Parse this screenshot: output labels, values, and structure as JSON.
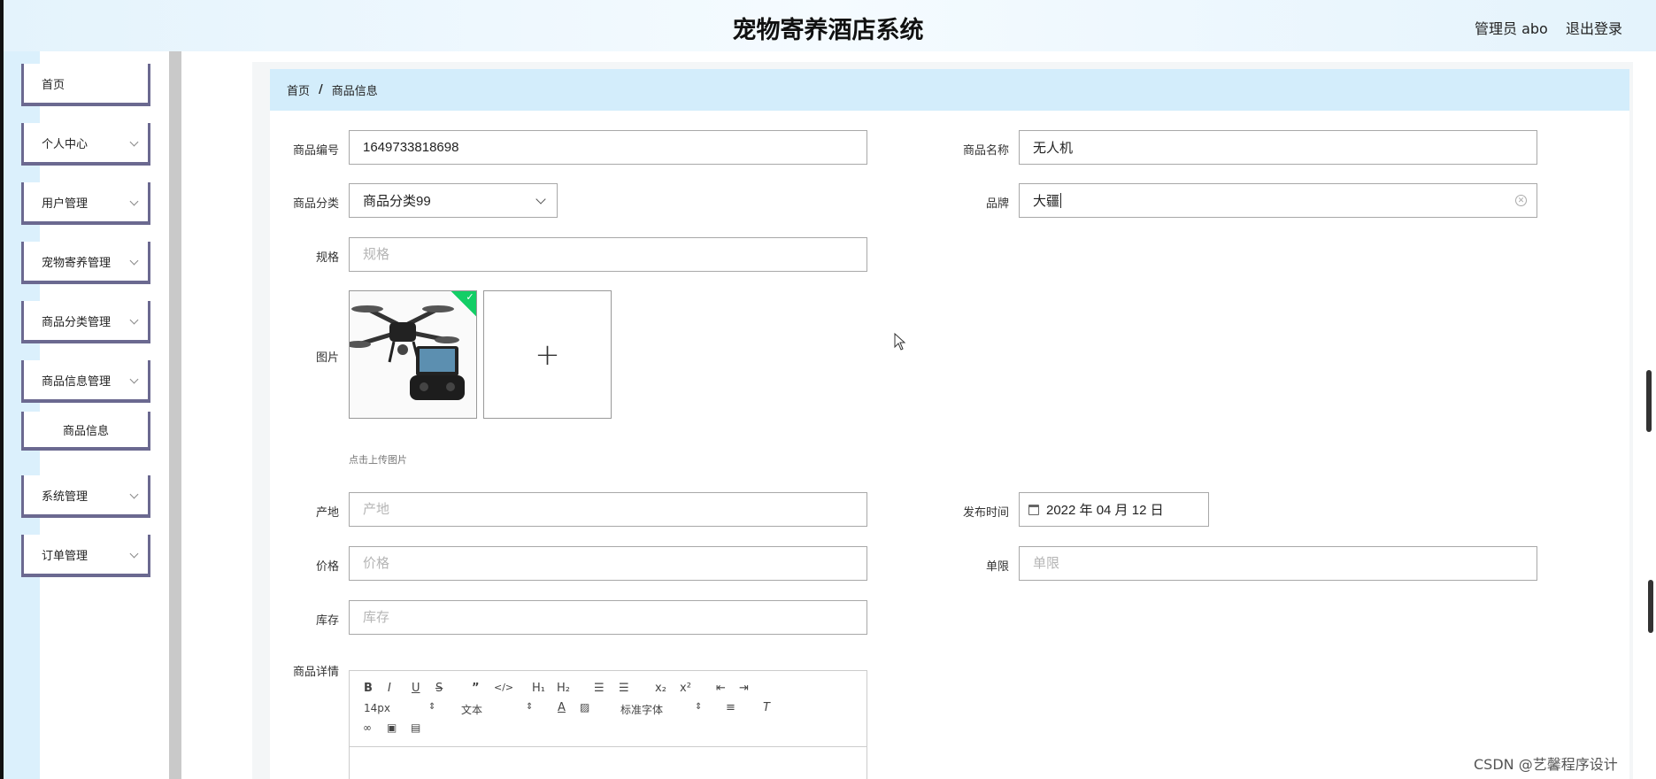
{
  "header": {
    "title": "宠物寄养酒店系统",
    "user": "管理员 abo",
    "logout": "退出登录"
  },
  "sidebar": {
    "items": [
      {
        "label": "首页",
        "has_children": false
      },
      {
        "label": "个人中心",
        "has_children": true
      },
      {
        "label": "用户管理",
        "has_children": true
      },
      {
        "label": "宠物寄养管理",
        "has_children": true
      },
      {
        "label": "商品分类管理",
        "has_children": true
      },
      {
        "label": "商品信息管理",
        "has_children": true
      },
      {
        "label": "商品信息",
        "has_children": false,
        "sub": true
      },
      {
        "label": "系统管理",
        "has_children": true
      },
      {
        "label": "订单管理",
        "has_children": true
      }
    ]
  },
  "breadcrumb": {
    "home": "首页",
    "separator": "/",
    "current": "商品信息"
  },
  "form": {
    "code": {
      "label": "商品编号",
      "value": "1649733818698"
    },
    "name": {
      "label": "商品名称",
      "value": "无人机"
    },
    "category": {
      "label": "商品分类",
      "value": "商品分类99"
    },
    "brand": {
      "label": "品牌",
      "value": "大疆"
    },
    "spec": {
      "label": "规格",
      "placeholder": "规格"
    },
    "image": {
      "label": "图片",
      "hint": "点击上传图片",
      "add_symbol": "+"
    },
    "origin": {
      "label": "产地",
      "placeholder": "产地"
    },
    "publish_date": {
      "label": "发布时间",
      "value": "2022 年 04 月 12 日"
    },
    "price": {
      "label": "价格",
      "placeholder": "价格"
    },
    "limit": {
      "label": "单限",
      "placeholder": "单限"
    },
    "stock": {
      "label": "库存",
      "placeholder": "库存"
    },
    "detail": {
      "label": "商品详情"
    }
  },
  "editor": {
    "font_size": "14px",
    "paragraph": "文本",
    "font_family": "标准字体"
  },
  "colors": {
    "header_bg": "#e4f3fc",
    "breadcrumb_bg": "#d3edfb",
    "menu_border": "#6b6990",
    "success": "#13ce66"
  },
  "watermark": "CSDN @艺馨程序设计"
}
